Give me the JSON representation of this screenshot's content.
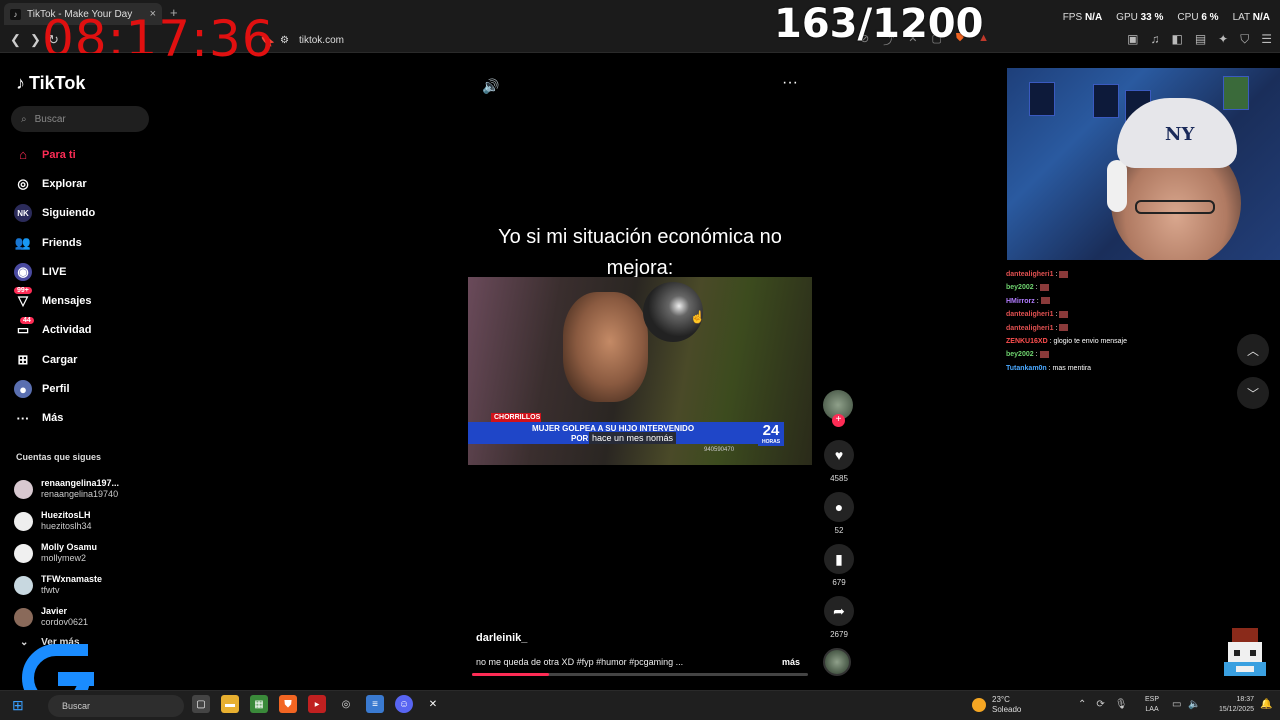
{
  "browser": {
    "tab_title": "TikTok - Make Your Day",
    "tab_close": "×",
    "new_tab": "+",
    "url": "tiktok.com"
  },
  "overlay": {
    "clock": "08:17:36",
    "counter": "163/1200",
    "fps_label": "FPS",
    "fps_value": "N/A",
    "gpu_label": "GPU",
    "gpu_value": "33 %",
    "cpu_label": "CPU",
    "cpu_value": "6 %",
    "lat_label": "LAT",
    "lat_value": "N/A"
  },
  "sidebar": {
    "logo": "TikTok",
    "search_placeholder": "Buscar",
    "items": [
      {
        "label": "Para ti",
        "icon": "home-icon"
      },
      {
        "label": "Explorar",
        "icon": "compass-icon"
      },
      {
        "label": "Siguiendo",
        "icon": "following-icon"
      },
      {
        "label": "Friends",
        "icon": "friends-icon"
      },
      {
        "label": "LIVE",
        "icon": "live-icon"
      },
      {
        "label": "Mensajes",
        "icon": "messages-icon",
        "badge": "99+"
      },
      {
        "label": "Actividad",
        "icon": "activity-icon",
        "badge": "44"
      },
      {
        "label": "Cargar",
        "icon": "upload-icon"
      },
      {
        "label": "Perfil",
        "icon": "profile-icon"
      },
      {
        "label": "Más",
        "icon": "more-icon"
      }
    ],
    "following_title": "Cuentas que sigues",
    "following": [
      {
        "name": "renaangelina197...",
        "handle": "renaangelina19740"
      },
      {
        "name": "HuezitosLH",
        "handle": "huezitoslh34"
      },
      {
        "name": "Molly Osamu",
        "handle": "mollymew2"
      },
      {
        "name": "TFWxnamaste",
        "handle": "tfwtv"
      },
      {
        "name": "Javier",
        "handle": "cordov0621"
      }
    ],
    "see_more": "Ver más"
  },
  "video": {
    "caption": "Yo si mi situación económica no mejora:",
    "news_location": "CHORRILLOS",
    "news_headline_1": "MUJER GOLPEA A SU HIJO INTERVENIDO",
    "news_headline_2": "POR",
    "news_channel": "24",
    "news_channel_sub": "HORAS",
    "news_phone": "940590470",
    "tooltip": "hace un mes nomás",
    "author": "darleinik_",
    "description": "no me queda de otra XD #fyp #humor #pcgaming ...",
    "more_label": "más",
    "progress": 0.23
  },
  "actions": {
    "likes": "4585",
    "comments": "52",
    "saves": "679",
    "shares": "2679"
  },
  "chat": [
    {
      "user": "dantealigheri1",
      "text": ":",
      "color": "#e05050",
      "emote": true
    },
    {
      "user": "bey2002",
      "text": ":",
      "color": "#6fd36f",
      "emote": true
    },
    {
      "user": "HMirrorz",
      "text": ":",
      "color": "#b27cff",
      "emote": true
    },
    {
      "user": "dantealigheri1",
      "text": ":",
      "color": "#e05050",
      "emote": true
    },
    {
      "user": "dantealigheri1",
      "text": ":",
      "color": "#e05050",
      "emote": true
    },
    {
      "user": "ZENKU16XD",
      "text": ": glogio te envio mensaje",
      "color": "#ff4f4f",
      "emote": false
    },
    {
      "user": "bey2002",
      "text": ":",
      "color": "#6fd36f",
      "emote": true
    },
    {
      "user": "Tutankam0n",
      "text": ": mas mentira",
      "color": "#4aa8ff",
      "emote": false
    }
  ],
  "taskbar": {
    "search": "Buscar",
    "temp": "23°C",
    "weather": "Soleado",
    "lang_1": "ESP",
    "lang_2": "LAA",
    "time": "18:37",
    "date": "15/12/2025"
  },
  "colors": {
    "accent": "#fe2c55",
    "clock": "#e01010",
    "news_blue": "#1f46c8"
  }
}
